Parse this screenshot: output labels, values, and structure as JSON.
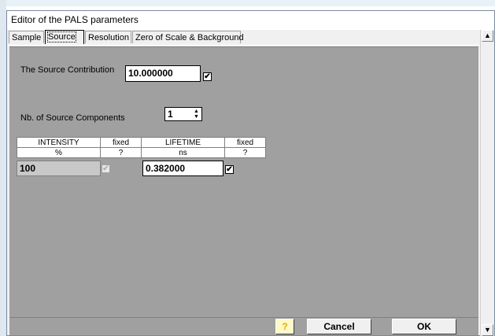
{
  "window": {
    "title": "Editor of the PALS parameters"
  },
  "tabs": [
    {
      "label": "Sample",
      "active": false
    },
    {
      "label": "Source",
      "active": true
    },
    {
      "label": "Resolution",
      "active": false
    },
    {
      "label": "Zero of Scale & Background",
      "active": false
    }
  ],
  "source": {
    "contribution_label": "The Source Contribution",
    "contribution_value": "10.000000",
    "contribution_fixed": true,
    "components_label": "Nb. of Source Components",
    "components_value": "1"
  },
  "grid": {
    "headers": [
      "INTENSITY",
      "fixed",
      "LIFETIME",
      "fixed"
    ],
    "units": [
      "%",
      "?",
      "ns",
      "?"
    ],
    "rows": [
      {
        "intensity": "100",
        "intensity_fixed": true,
        "lifetime": "0.382000",
        "lifetime_fixed": true
      }
    ]
  },
  "buttons": {
    "help": "?",
    "cancel": "Cancel",
    "ok": "OK"
  },
  "icons": {
    "checkmark": "✔",
    "spin_up": "▲",
    "spin_down": "▼",
    "scroll_up": "▲",
    "scroll_down": "▼"
  }
}
